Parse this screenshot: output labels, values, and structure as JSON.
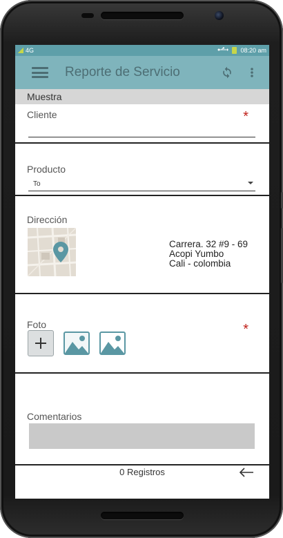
{
  "status_bar": {
    "network": "4G",
    "time": "08:20 am"
  },
  "app_bar": {
    "title": "Reporte de Servicio",
    "menu_icon": "hamburger-icon",
    "sync_icon": "sync-icon",
    "overflow_icon": "more-vert-icon"
  },
  "section": {
    "title": "Muestra"
  },
  "form": {
    "cliente": {
      "label": "Cliente",
      "required_mark": "*",
      "value": ""
    },
    "producto": {
      "label": "Producto",
      "selected": "To"
    },
    "direccion": {
      "label": "Dirección",
      "line1": "Carrera. 32 #9 - 69",
      "line2": "Acopi Yumbo",
      "line3": "Cali - colombia"
    },
    "foto": {
      "label": "Foto",
      "required_mark": "*",
      "add_symbol": "+"
    },
    "comentarios": {
      "label": "Comentarios",
      "value": ""
    }
  },
  "footer": {
    "count": "0 Registros"
  },
  "colors": {
    "status_bar": "#5e9fa9",
    "app_bar": "#7fb4bc",
    "app_bar_text": "#4d6e74",
    "required": "#c0201a",
    "image_icon": "#5a97a3",
    "section_bg": "#d6d6d6"
  }
}
